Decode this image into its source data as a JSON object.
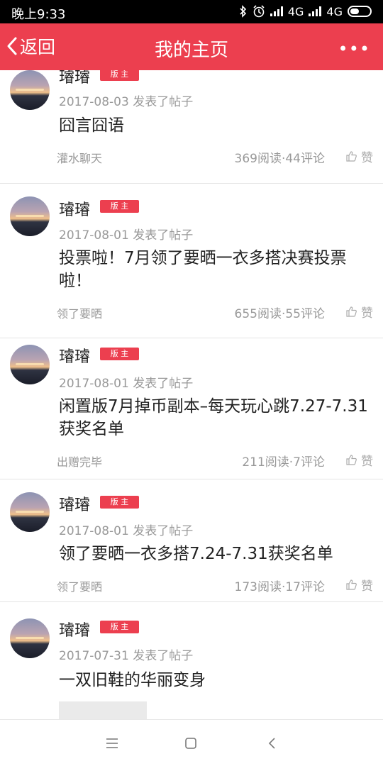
{
  "status_bar": {
    "time": "晚上9:33",
    "indicators": [
      "bluetooth-icon",
      "alarm-icon",
      "signal-icon",
      "4G",
      "signal-icon",
      "4G",
      "battery-icon"
    ],
    "network_1": "4G",
    "network_2": "4G"
  },
  "header": {
    "back_label": "返回",
    "title": "我的主页",
    "more_label": "•••",
    "accent_color": "#ec3f4f"
  },
  "posts": [
    {
      "user": "璿璿",
      "badge": "版 主",
      "meta": "2017-08-03 发表了帖子",
      "title": "囧言囧语",
      "board": "灌水聊天",
      "stats": "369阅读·44评论",
      "like": "赞"
    },
    {
      "user": "璿璿",
      "badge": "版 主",
      "meta": "2017-08-01 发表了帖子",
      "title": "投票啦！7月领了要晒一衣多搭决赛投票啦！",
      "board": "领了要晒",
      "stats": "655阅读·55评论",
      "like": "赞"
    },
    {
      "user": "璿璿",
      "badge": "版 主",
      "meta": "2017-08-01 发表了帖子",
      "title": "闲置版7月掉币副本–每天玩心跳7.27-7.31获奖名单",
      "board": "出赠完毕",
      "stats": "211阅读·7评论",
      "like": "赞"
    },
    {
      "user": "璿璿",
      "badge": "版 主",
      "meta": "2017-08-01 发表了帖子",
      "title": "领了要晒一衣多搭7.24-7.31获奖名单",
      "board": "领了要晒",
      "stats": "173阅读·17评论",
      "like": "赞"
    },
    {
      "user": "璿璿",
      "badge": "版 主",
      "meta": "2017-07-31 发表了帖子",
      "title": "一双旧鞋的华丽变身"
    }
  ],
  "system_nav": {
    "items": [
      "menu-icon",
      "home-icon",
      "back-icon"
    ]
  }
}
